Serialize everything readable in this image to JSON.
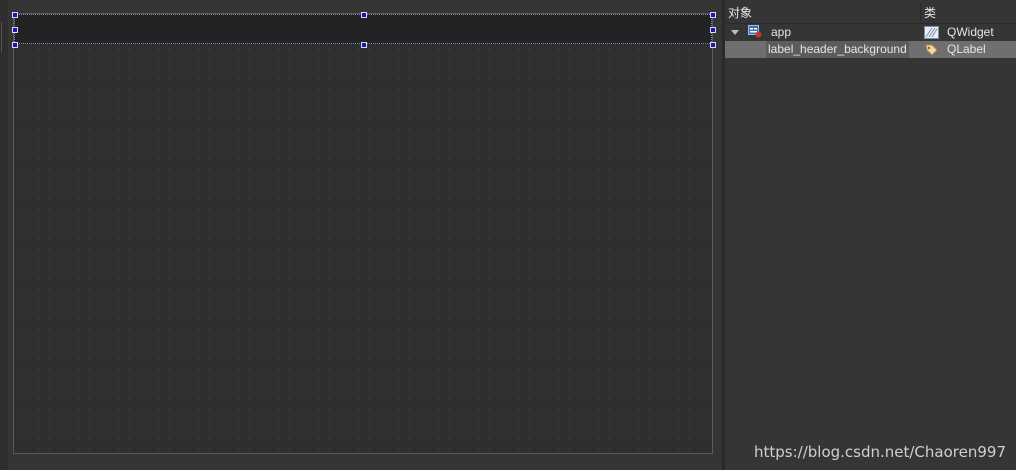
{
  "inspector": {
    "columns": {
      "object": "对象",
      "class": "类"
    },
    "tree": [
      {
        "object_name": "app",
        "class_name": "QWidget",
        "expanded": true,
        "icon": "form-icon",
        "class_icon": "widget-icon"
      },
      {
        "object_name": "label_header_background",
        "class_name": "QLabel",
        "selected": true,
        "class_icon": "label-tag-icon"
      }
    ]
  },
  "watermark": "https://blog.csdn.net/Chaoren997",
  "colors": {
    "background": "#353535",
    "header_label": "#232325",
    "selection": "#6f6f6f",
    "handle": "#1a1aa8"
  }
}
